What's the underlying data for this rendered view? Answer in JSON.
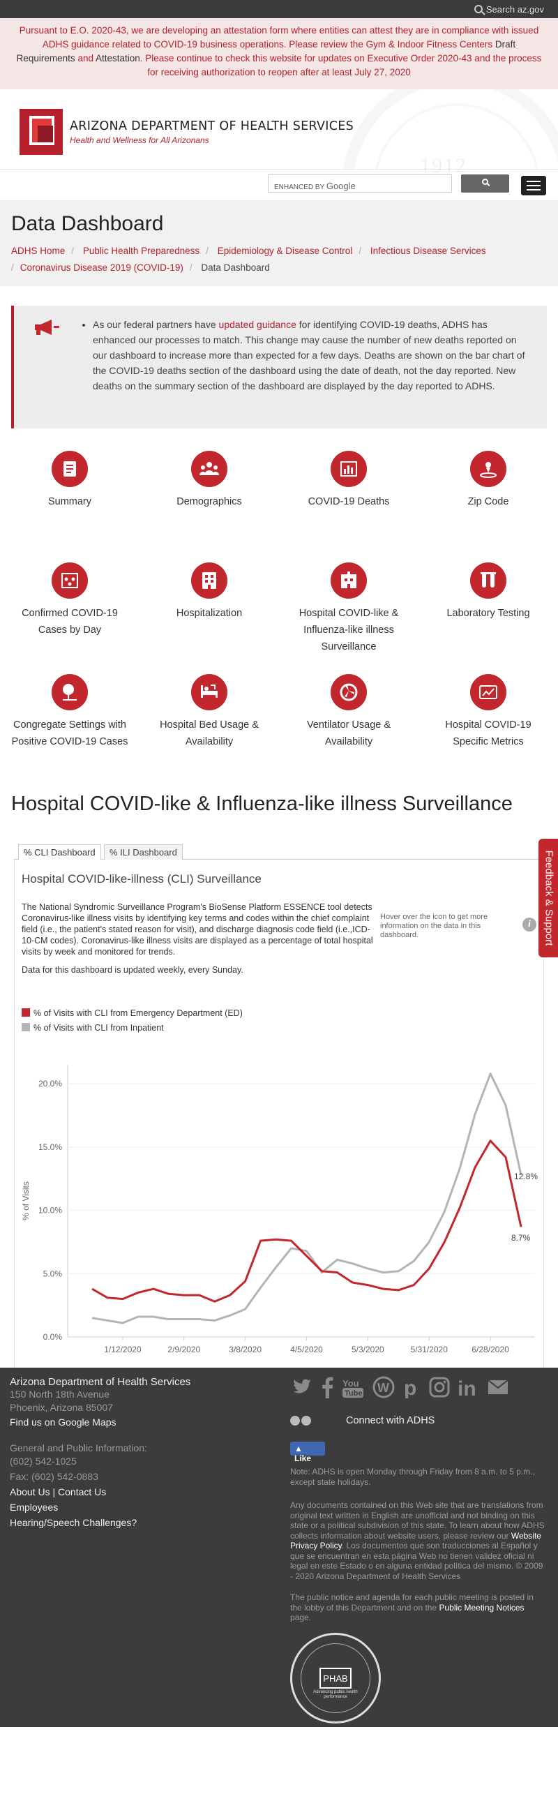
{
  "topbar": {
    "search_link": "Search az.gov"
  },
  "alert": {
    "part1": "Pursuant to E.O. 2020-43, we are developing an attestation form where entities can attest they are in compliance with issued ADHS guidance related to COVID-19 business operations. Please review the Gym & Indoor Fitness Centers",
    "link1": "Draft Requirements",
    "and": "and",
    "link2": "Attestation",
    "part2": ". Please continue to check this website for updates on Executive Order 2020-43 and the process for receiving authorization to reopen after at least July 27, 2020"
  },
  "header": {
    "title": "ARIZONA DEPARTMENT OF HEALTH SERVICES",
    "subtitle": "Health and Wellness for All Arizonans",
    "seal_year": "1912"
  },
  "search": {
    "enhanced_by": "ENHANCED BY",
    "google": "Google"
  },
  "page": {
    "title": "Data Dashboard"
  },
  "breadcrumbs": [
    "ADHS Home",
    "Public Health Preparedness",
    "Epidemiology & Disease Control",
    "Infectious Disease Services",
    "Coronavirus Disease 2019 (COVID-19)",
    "Data Dashboard"
  ],
  "notice": {
    "before": "As our federal partners have",
    "link": "updated guidance",
    "after": "for identifying COVID-19 deaths, ADHS has enhanced our processes to match. This change may cause the number of new deaths reported on our dashboard to increase more than expected for a few days. Deaths are shown on the bar chart of the COVID-19 deaths section of the dashboard using the date of death, not the day reported. New deaths on the summary section of the dashboard are displayed by the day reported to ADHS."
  },
  "tiles": [
    {
      "label": "Summary",
      "icon": "summary-icon"
    },
    {
      "label": "Demographics",
      "icon": "demographics-icon"
    },
    {
      "label": "COVID-19 Deaths",
      "icon": "deaths-chart-icon"
    },
    {
      "label": "Zip Code",
      "icon": "zip-code-icon"
    },
    {
      "label": "Confirmed COVID-19 Cases by Day",
      "icon": "cases-by-day-icon"
    },
    {
      "label": "Hospitalization",
      "icon": "hospitalization-icon"
    },
    {
      "label": "Hospital COVID-like & Influenza-like illness Surveillance",
      "icon": "hospital-surveillance-icon"
    },
    {
      "label": "Laboratory Testing",
      "icon": "lab-testing-icon"
    },
    {
      "label": "Congregate Settings with Positive COVID-19 Cases",
      "icon": "congregate-settings-icon"
    },
    {
      "label": "Hospital Bed Usage & Availability",
      "icon": "hospital-bed-icon"
    },
    {
      "label": "Ventilator Usage & Availability",
      "icon": "ventilator-icon"
    },
    {
      "label": "Hospital COVID-19 Specific Metrics",
      "icon": "hospital-metrics-icon"
    }
  ],
  "section": {
    "title": "Hospital COVID-like & Influenza-like illness Surveillance"
  },
  "tabs": [
    "% CLI Dashboard",
    "% ILI Dashboard"
  ],
  "dashboard": {
    "title": "Hospital COVID-like-illness (CLI) Surveillance",
    "description": "The National Syndromic Surveillance Program's BioSense Platform ESSENCE tool detects Coronavirus-like illness visits by identifying key terms and codes within the chief complaint field (i.e., the patient's stated reason for visit), and discharge diagnosis code field (i.e.,ICD-10-CM codes).  Coronavirus-like illness visits are displayed as a percentage of total hospital visits by week and monitored for trends.",
    "update_note": "Data for this dashboard is updated weekly, every Sunday.",
    "hover_hint": "Hover over the icon to get more information on the data in this dashboard.",
    "info_glyph": "i"
  },
  "colors": {
    "accent": "#c1272d",
    "ed_series": "#c1272d",
    "inpatient_series": "#b4b4b4"
  },
  "chart_data": {
    "type": "line",
    "title": "",
    "xlabel": "",
    "ylabel": "% of Visits",
    "ylim": [
      0,
      21.5
    ],
    "y_ticks": [
      "0.0%",
      "5.0%",
      "10.0%",
      "15.0%",
      "20.0%"
    ],
    "x_tick_labels": [
      "1/12/2020",
      "2/9/2020",
      "3/8/2020",
      "4/5/2020",
      "5/3/2020",
      "5/31/2020",
      "6/28/2020"
    ],
    "grid": true,
    "legend_position": "top-left",
    "x": [
      "12/29/2019",
      "1/5/2020",
      "1/12/2020",
      "1/19/2020",
      "1/26/2020",
      "2/2/2020",
      "2/9/2020",
      "2/16/2020",
      "2/23/2020",
      "3/1/2020",
      "3/8/2020",
      "3/15/2020",
      "3/22/2020",
      "3/29/2020",
      "4/5/2020",
      "4/12/2020",
      "4/19/2020",
      "4/26/2020",
      "5/3/2020",
      "5/10/2020",
      "5/17/2020",
      "5/24/2020",
      "5/31/2020",
      "6/7/2020",
      "6/14/2020",
      "6/21/2020",
      "6/28/2020",
      "7/5/2020",
      "7/12/2020"
    ],
    "series": [
      {
        "name": "% of Visits with CLI from Emergency Department (ED)",
        "values": [
          3.8,
          3.1,
          3.0,
          3.5,
          3.8,
          3.4,
          3.3,
          3.3,
          2.8,
          3.3,
          4.4,
          7.6,
          7.7,
          7.6,
          6.4,
          5.2,
          5.1,
          4.3,
          4.1,
          3.8,
          3.7,
          4.1,
          5.4,
          7.5,
          10.2,
          13.4,
          15.5,
          14.2,
          8.7
        ]
      },
      {
        "name": "% of Visits with CLI from Inpatient",
        "values": [
          1.5,
          1.3,
          1.1,
          1.6,
          1.6,
          1.4,
          1.4,
          1.4,
          1.3,
          1.7,
          2.2,
          3.9,
          5.5,
          7.0,
          6.8,
          5.1,
          6.1,
          5.8,
          5.4,
          5.1,
          5.2,
          6.0,
          7.5,
          9.9,
          13.3,
          17.6,
          20.8,
          18.3,
          12.8
        ]
      }
    ],
    "end_labels": [
      "8.7%",
      "12.8%"
    ]
  },
  "feedback": {
    "label": "Feedback & Support"
  },
  "footer": {
    "org": "Arizona Department of Health Services",
    "address1": "150 North 18th Avenue",
    "address2": "Phoenix, Arizona 85007",
    "maps_link": "Find us on Google Maps",
    "general_heading": "General and Public Information:",
    "phone": "(602) 542-1025",
    "fax": "Fax: (602) 542-0883",
    "about": "About Us",
    "sep": " | ",
    "contact": "Contact Us",
    "employees": "Employees",
    "hearing": "Hearing/Speech Challenges?",
    "social_icons": [
      "twitter-icon",
      "facebook-icon",
      "youtube-icon",
      "wordpress-icon",
      "pinterest-icon",
      "instagram-icon",
      "linkedin-icon",
      "email-icon"
    ],
    "connect": "Connect with ADHS",
    "like": "Like",
    "note": "Note: ADHS is open Monday through Friday from 8 a.m. to 5 p.m., except state holidays.",
    "translation_a": "Any documents contained on this Web site that are translations from original text written in English are unofficial and not binding on this state or a political subdivision of this state. To learn about how ADHS collects information about website users, please review our",
    "privacy_link": "Website Privacy Policy",
    "translation_b": ". Los documentos que son traducciones al Español y que se encuentran en esta página Web no tienen validez oficial ni legal en este Estado o en alguna entidad política del mismo. © 2009 - 2020 Arizona Department of Health Services",
    "meeting_a": "The public notice and agenda for each public meeting is posted in the lobby of this Department and on the",
    "meeting_link": "Public Meeting Notices",
    "meeting_b": "page.",
    "phab": "PHAB",
    "phab_sub": "Advancing public health performance"
  }
}
